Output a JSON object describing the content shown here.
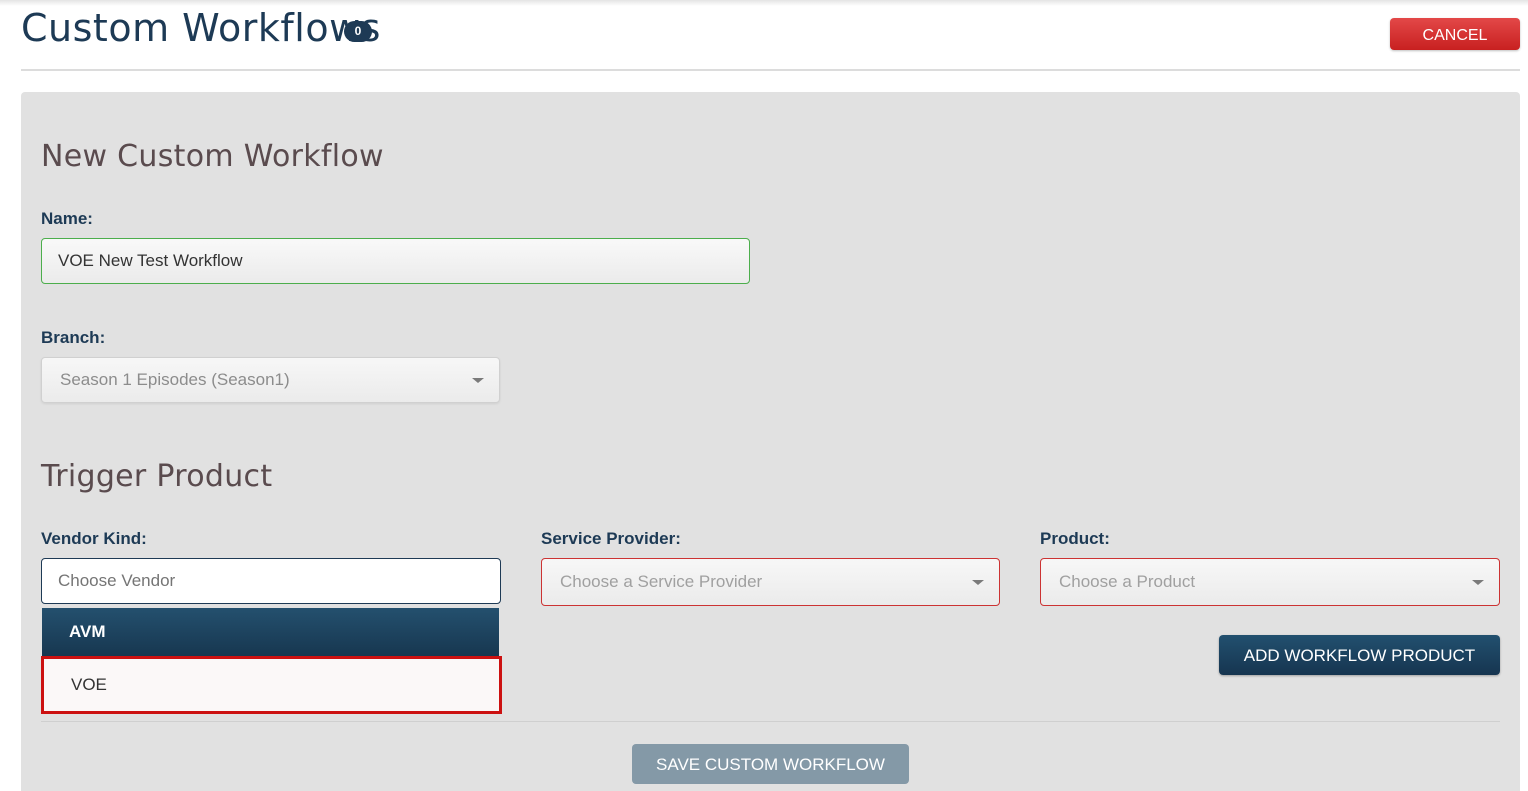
{
  "header": {
    "title": "Custom Workflows",
    "count_badge": "0",
    "cancel_label": "CANCEL"
  },
  "form": {
    "heading": "New Custom Workflow",
    "name_label": "Name:",
    "name_value": "VOE New Test Workflow",
    "branch_label": "Branch:",
    "branch_value": "Season 1 Episodes (Season1)"
  },
  "trigger": {
    "heading": "Trigger Product",
    "vendor_label": "Vendor Kind:",
    "vendor_placeholder": "Choose Vendor",
    "vendor_options": [
      "AVM",
      "VOE"
    ],
    "provider_label": "Service Provider:",
    "provider_placeholder": "Choose a Service Provider",
    "product_label": "Product:",
    "product_placeholder": "Choose a Product",
    "add_product_label": "ADD WORKFLOW PRODUCT"
  },
  "footer": {
    "save_label": "SAVE CUSTOM WORKFLOW"
  },
  "colors": {
    "brand_navy": "#1e3a55",
    "cancel_red": "#d93030",
    "highlight_red": "#cc1111",
    "valid_green": "#4cae4c"
  }
}
